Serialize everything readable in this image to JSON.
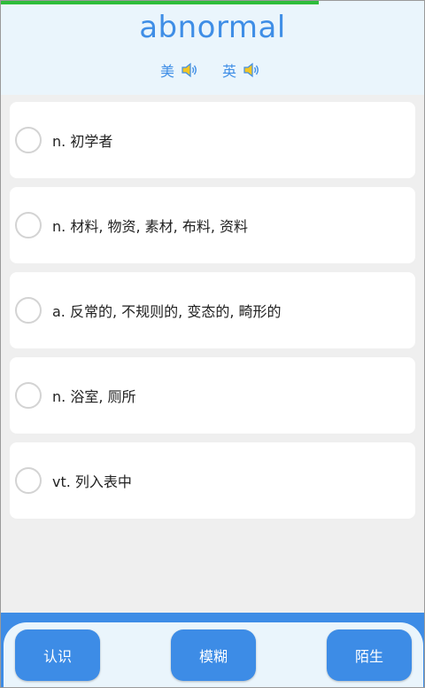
{
  "progress": {
    "fraction": 0.75,
    "color": "#2ebd3b"
  },
  "word": "abnormal",
  "pronunciation": {
    "us_label": "美",
    "uk_label": "英",
    "icon": "speaker-icon"
  },
  "options": [
    {
      "text": "n. 初学者"
    },
    {
      "text": "n. 材料, 物资, 素材, 布料, 资料"
    },
    {
      "text": "a. 反常的, 不规则的, 变态的, 畸形的"
    },
    {
      "text": "n. 浴室, 厕所"
    },
    {
      "text": "vt. 列入表中"
    }
  ],
  "buttons": {
    "know": "认识",
    "vague": "模糊",
    "strange": "陌生"
  },
  "colors": {
    "accent": "#3d8ce6",
    "header_bg": "#eaf5fc",
    "page_bg": "#efefef"
  }
}
